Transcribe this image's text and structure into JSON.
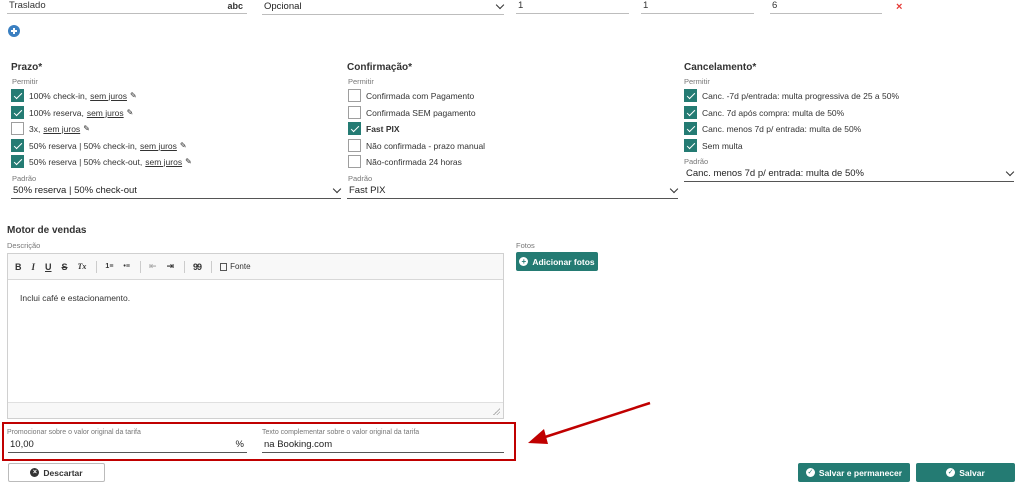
{
  "service_row": {
    "name": "Traslado",
    "name_suffix": "abc",
    "type": "Opcional",
    "field1": "1",
    "field2": "1",
    "field3": "6",
    "remove": "×"
  },
  "add_icon": "plus-circle-icon",
  "prazo": {
    "title": "Prazo*",
    "permitir": "Permitir",
    "items": [
      {
        "text": "100% check-in,",
        "link": "sem juros",
        "checked": true
      },
      {
        "text": "100% reserva,",
        "link": "sem juros",
        "checked": true
      },
      {
        "text": "3x,",
        "link": "sem juros",
        "checked": false
      },
      {
        "text": "50% reserva | 50% check-in,",
        "link": "sem juros",
        "checked": true
      },
      {
        "text": "50% reserva | 50% check-out,",
        "link": "sem juros",
        "checked": true
      }
    ],
    "padrao_label": "Padrão",
    "padrao_value": "50% reserva | 50% check-out"
  },
  "confirmacao": {
    "title": "Confirmação*",
    "permitir": "Permitir",
    "items": [
      {
        "text": "Confirmada com Pagamento",
        "checked": false
      },
      {
        "text": "Confirmada SEM pagamento",
        "checked": false
      },
      {
        "text": "Fast PIX",
        "checked": true
      },
      {
        "text": "Não confirmada - prazo manual",
        "checked": false
      },
      {
        "text": "Não-confirmada 24 horas",
        "checked": false
      }
    ],
    "padrao_label": "Padrão",
    "padrao_value": "Fast PIX"
  },
  "cancelamento": {
    "title": "Cancelamento*",
    "permitir": "Permitir",
    "items": [
      {
        "text": "Canc. -7d p/entrada: multa progressiva de 25 a 50%",
        "checked": true
      },
      {
        "text": "Canc. 7d após compra: multa de 50%",
        "checked": true
      },
      {
        "text": "Canc. menos 7d p/ entrada: multa de 50%",
        "checked": true
      },
      {
        "text": "Sem multa",
        "checked": true
      }
    ],
    "padrao_label": "Padrão",
    "padrao_value": "Canc. menos 7d p/ entrada: multa de 50%"
  },
  "motor": {
    "title": "Motor de vendas",
    "descricao_label": "Descrição",
    "toolbar": {
      "bold": "B",
      "italic": "I",
      "underline": "U",
      "strike": "S",
      "clear": "Tx",
      "ol": "1≡",
      "ul": "•≡",
      "outdent": "⇤",
      "indent": "⇥",
      "quote": "99",
      "source": "Fonte"
    },
    "description_text": "Inclui café e estacionamento.",
    "fotos_label": "Fotos",
    "add_photos": "Adicionar fotos"
  },
  "promo": {
    "label": "Promocionar sobre o valor original da tarifa",
    "value": "10,00",
    "unit": "%",
    "text_label": "Texto complementar sobre o valor original da tarifa",
    "text_value": "na Booking.com"
  },
  "actions": {
    "discard": "Descartar",
    "save_stay": "Salvar e permanecer",
    "save": "Salvar"
  },
  "colors": {
    "accent": "#247b73",
    "highlight": "#c00000"
  }
}
